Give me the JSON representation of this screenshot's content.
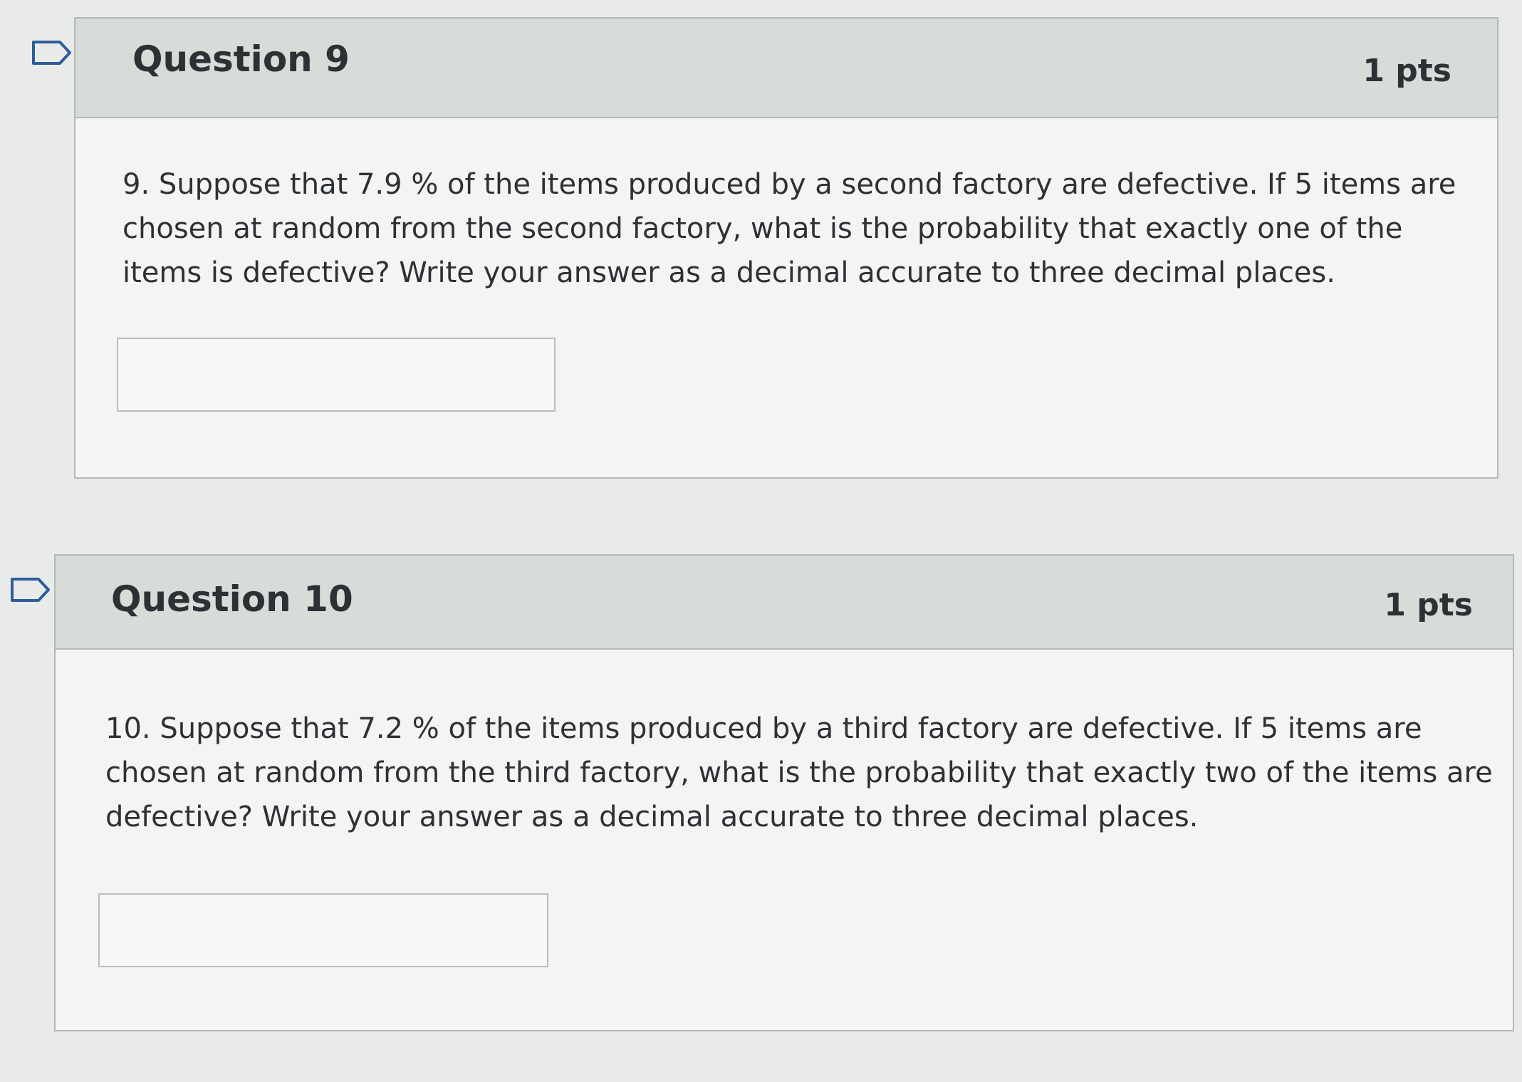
{
  "questions": [
    {
      "title": "Question 9",
      "points": "1 pts",
      "text": "9. Suppose that 7.9 % of the items produced by a second factory are defective. If 5 items are chosen at random from the second factory, what is the probability that exactly one of the items is defective? Write your answer as a decimal accurate to three decimal places.",
      "answer_value": "",
      "flag_icon": "flag-outline-icon"
    },
    {
      "title": "Question 10",
      "points": "1 pts",
      "text": "10. Suppose that 7.2 % of the items produced by a third factory are defective. If 5 items are chosen at random from the third factory, what is the probability that exactly two of the items are defective? Write your answer as a decimal accurate to three decimal places.",
      "answer_value": "",
      "flag_icon": "flag-outline-icon"
    }
  ]
}
